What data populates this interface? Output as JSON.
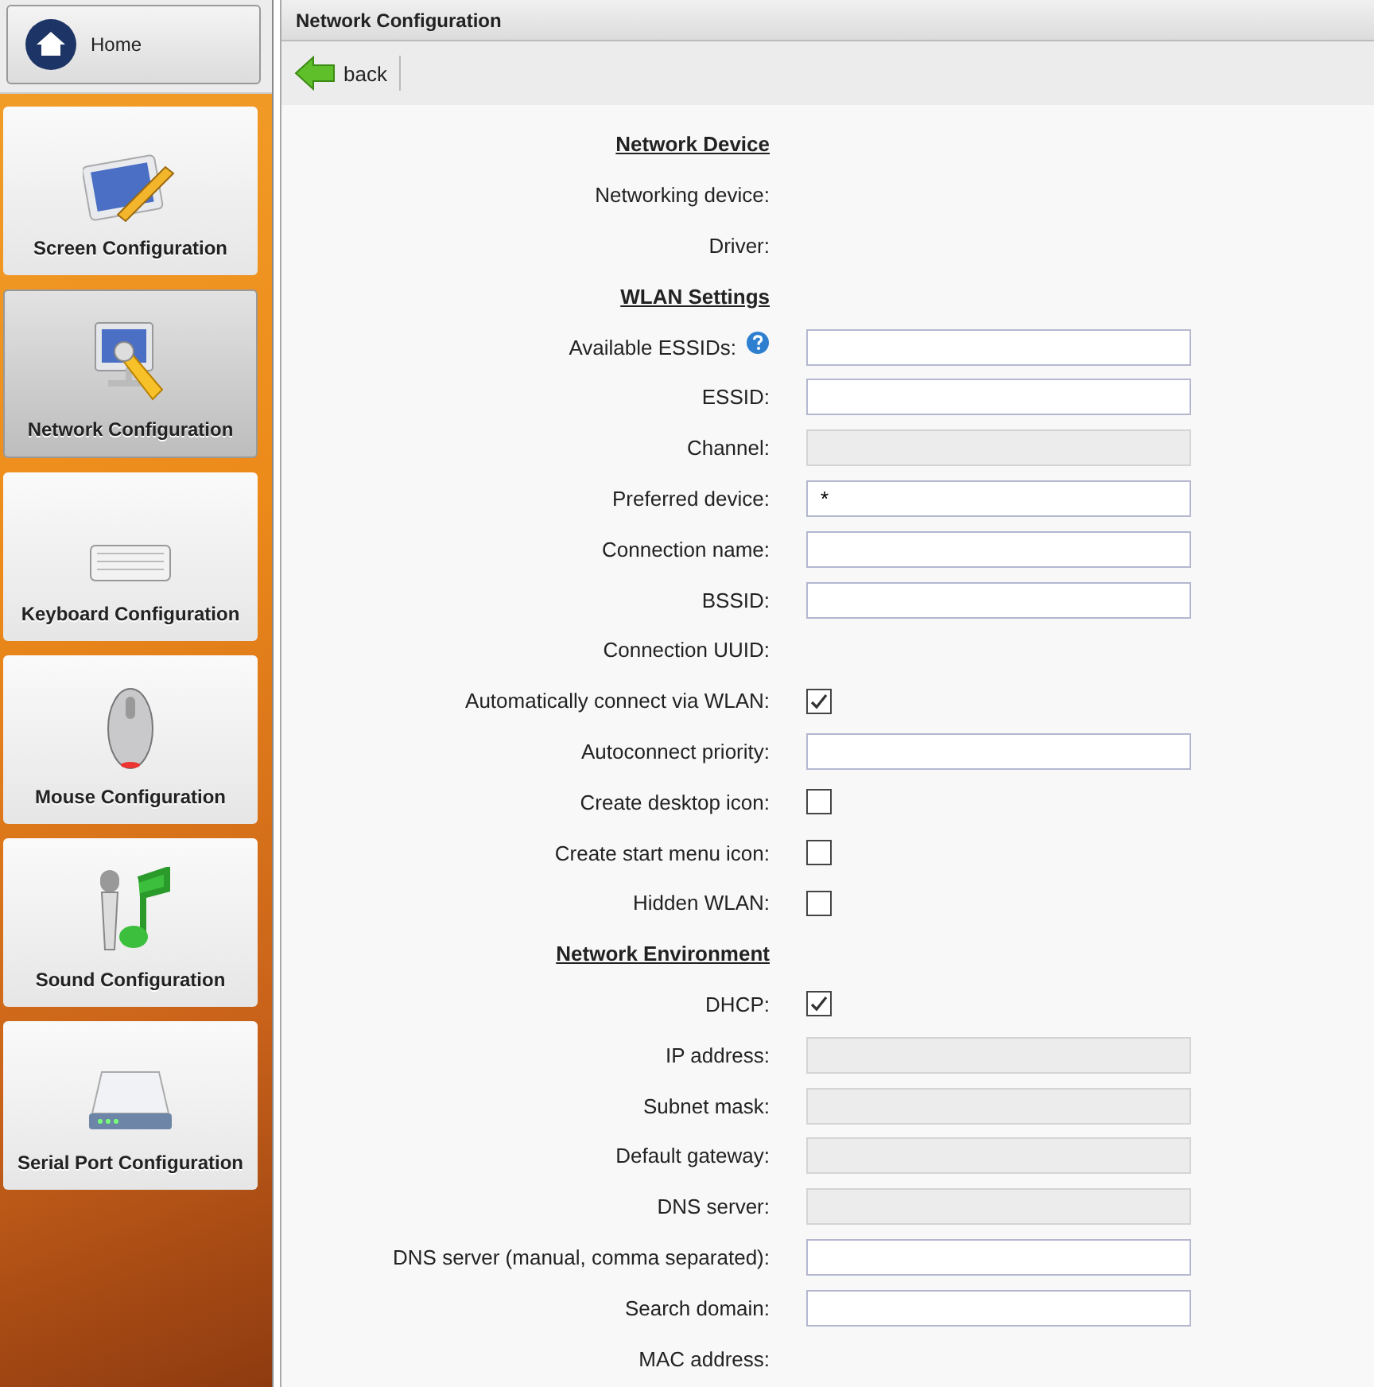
{
  "sidebar": {
    "home": "Home",
    "items": [
      {
        "label": "Screen Configuration",
        "selected": false
      },
      {
        "label": "Network Configuration",
        "selected": true
      },
      {
        "label": "Keyboard Configuration",
        "selected": false
      },
      {
        "label": "Mouse Configuration",
        "selected": false
      },
      {
        "label": "Sound Configuration",
        "selected": false
      },
      {
        "label": "Serial Port Configuration",
        "selected": false
      }
    ]
  },
  "main": {
    "title": "Network Configuration",
    "toolbar": {
      "back": "back"
    },
    "rows": [
      {
        "kind": "heading",
        "label": "Network Device"
      },
      {
        "kind": "text",
        "label": "Networking device:"
      },
      {
        "kind": "text",
        "label": "Driver:"
      },
      {
        "kind": "heading",
        "label": "WLAN Settings"
      },
      {
        "kind": "select",
        "label": "Available ESSIDs:",
        "help": true
      },
      {
        "kind": "input",
        "label": "ESSID:"
      },
      {
        "kind": "disabled",
        "label": "Channel:"
      },
      {
        "kind": "select",
        "label": "Preferred device:",
        "value": "*"
      },
      {
        "kind": "input",
        "label": "Connection name:"
      },
      {
        "kind": "input",
        "label": "BSSID:"
      },
      {
        "kind": "text",
        "label": "Connection UUID:"
      },
      {
        "kind": "checkbox",
        "label": "Automatically connect via WLAN:",
        "checked": true
      },
      {
        "kind": "input",
        "label": "Autoconnect priority:"
      },
      {
        "kind": "checkbox",
        "label": "Create desktop icon:",
        "checked": false
      },
      {
        "kind": "checkbox",
        "label": "Create start menu icon:",
        "checked": false
      },
      {
        "kind": "checkbox",
        "label": "Hidden WLAN:",
        "checked": false
      },
      {
        "kind": "heading",
        "label": "Network Environment"
      },
      {
        "kind": "checkbox",
        "label": "DHCP:",
        "checked": true
      },
      {
        "kind": "disabled",
        "label": "IP address:"
      },
      {
        "kind": "disabled",
        "label": "Subnet mask:"
      },
      {
        "kind": "disabled",
        "label": "Default gateway:"
      },
      {
        "kind": "disabled",
        "label": "DNS server:"
      },
      {
        "kind": "input",
        "label": "DNS server (manual, comma separated):"
      },
      {
        "kind": "input",
        "label": "Search domain:"
      },
      {
        "kind": "text",
        "label": "MAC address:"
      }
    ]
  }
}
